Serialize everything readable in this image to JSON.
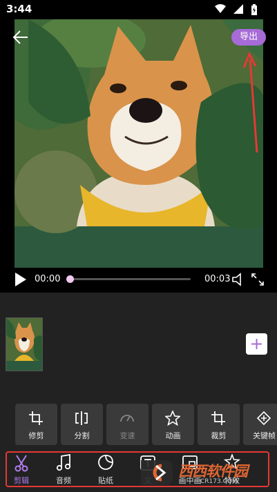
{
  "status": {
    "time": "3:44"
  },
  "header": {
    "export_label": "导出"
  },
  "player": {
    "current_time": "00:00",
    "total_time": "00:03",
    "progress": 0.0
  },
  "tools": [
    {
      "label": "修剪",
      "icon": "crop-icon",
      "enabled": true
    },
    {
      "label": "分割",
      "icon": "split-icon",
      "enabled": true
    },
    {
      "label": "变速",
      "icon": "speed-icon",
      "enabled": false
    },
    {
      "label": "动画",
      "icon": "star-icon",
      "enabled": true
    },
    {
      "label": "裁剪",
      "icon": "crop-icon",
      "enabled": true
    },
    {
      "label": "关键帧",
      "icon": "keyframe-icon",
      "enabled": true
    }
  ],
  "nav": {
    "active": "剪辑",
    "items": [
      {
        "label": "剪辑",
        "icon": "scissors-icon"
      },
      {
        "label": "音频",
        "icon": "music-icon"
      },
      {
        "label": "贴纸",
        "icon": "sticker-icon"
      },
      {
        "label": "文",
        "icon": "text-icon"
      },
      {
        "label": "画中画",
        "icon": "pip-icon"
      },
      {
        "label": "特效",
        "icon": "effects-icon"
      }
    ]
  },
  "watermark": {
    "text": "西西软件园",
    "sub": "CR173.COM"
  },
  "colors": {
    "accent": "#a66bd6",
    "active_tab": "#b27ef0",
    "highlight": "#e53935"
  }
}
